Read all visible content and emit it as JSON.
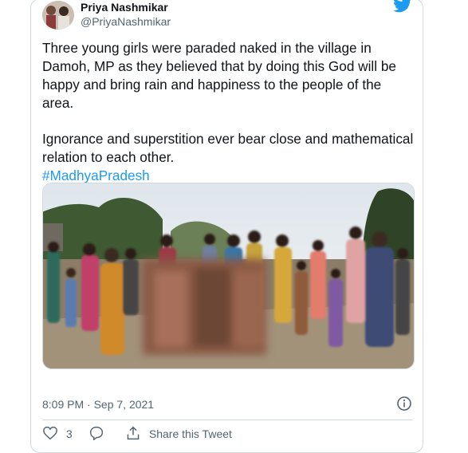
{
  "tweet": {
    "display_name": "Priya Nashmikar",
    "handle": "@PriyaNashmikar",
    "paragraph_1": "Three young girls were paraded naked in the village in Damoh, MP as they believed that by doing this God will be happy and bring rain and happiness to the people of the area.",
    "paragraph_2": "Ignorance and superstition ever bear close and mathematical relation to each other.",
    "hashtag": "#MadhyaPradesh",
    "timestamp": "8:09 PM · Sep 7, 2021",
    "like_count": "3",
    "share_label": "Share this Tweet"
  },
  "colors": {
    "accent": "#1d9bf0",
    "secondary_text": "#536471",
    "border": "#cfd9de"
  },
  "icons": [
    "avatar-image",
    "twitter-bird-icon",
    "info-icon",
    "heart-icon",
    "reply-bubble-icon",
    "share-icon"
  ]
}
